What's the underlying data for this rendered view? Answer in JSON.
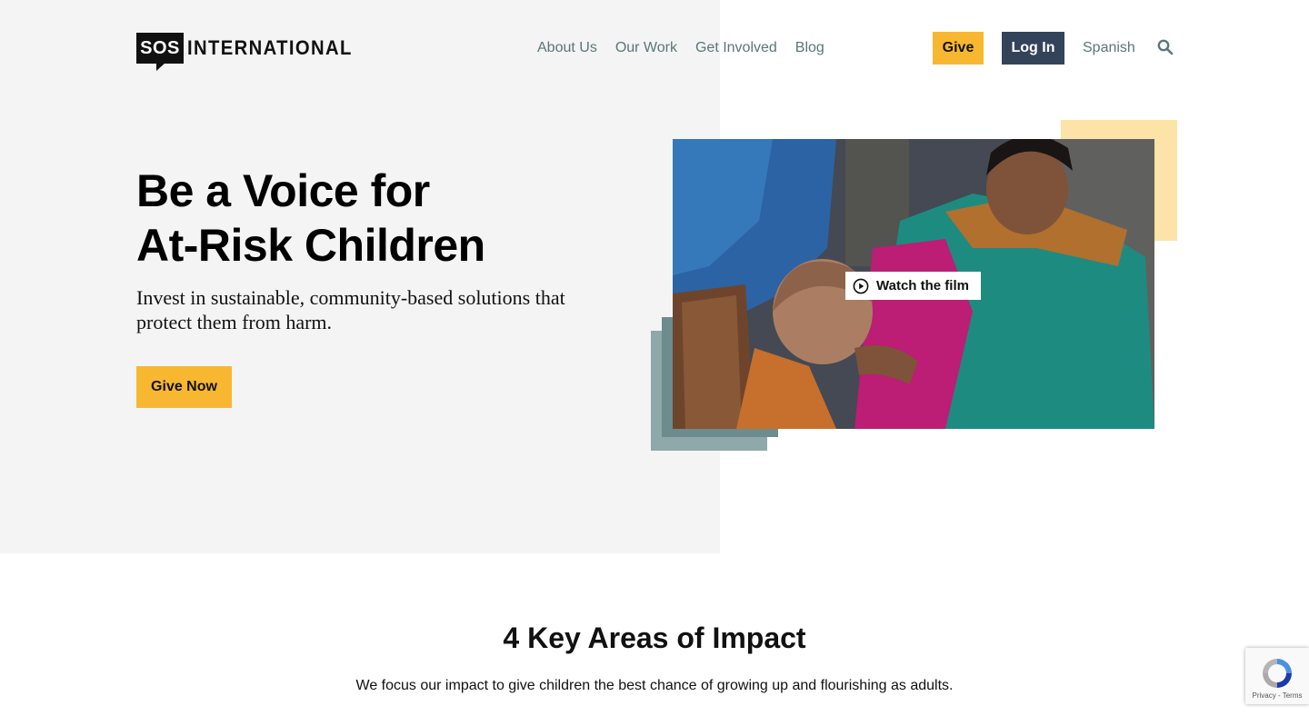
{
  "header": {
    "logo_mark": "SOS",
    "logo_word": "INTERNATIONAL",
    "nav": [
      "About Us",
      "Our Work",
      "Get Involved",
      "Blog"
    ],
    "give_label": "Give",
    "login_label": "Log In",
    "language_label": "Spanish",
    "search_icon": "search-icon"
  },
  "hero": {
    "title_line1": "Be a Voice for",
    "title_line2": "At-Risk Children",
    "subtitle": "Invest in sustainable, community-based solutions that protect them from harm.",
    "cta_label": "Give Now",
    "video_button_label": "Watch the film",
    "video_icon": "play-circle-icon"
  },
  "impact": {
    "title": "4 Key Areas of Impact",
    "subtitle": "We focus our impact to give children the best chance of growing up and flourishing as adults."
  },
  "recaptcha": {
    "text": "Privacy - Terms"
  },
  "colors": {
    "accent_yellow": "#f8b731",
    "navy": "#33435a",
    "nav_text": "#5b7678",
    "hero_bg": "#f4f4f4",
    "deco_teal": "#6c8c8e",
    "deco_yellow": "#fde3a7"
  }
}
